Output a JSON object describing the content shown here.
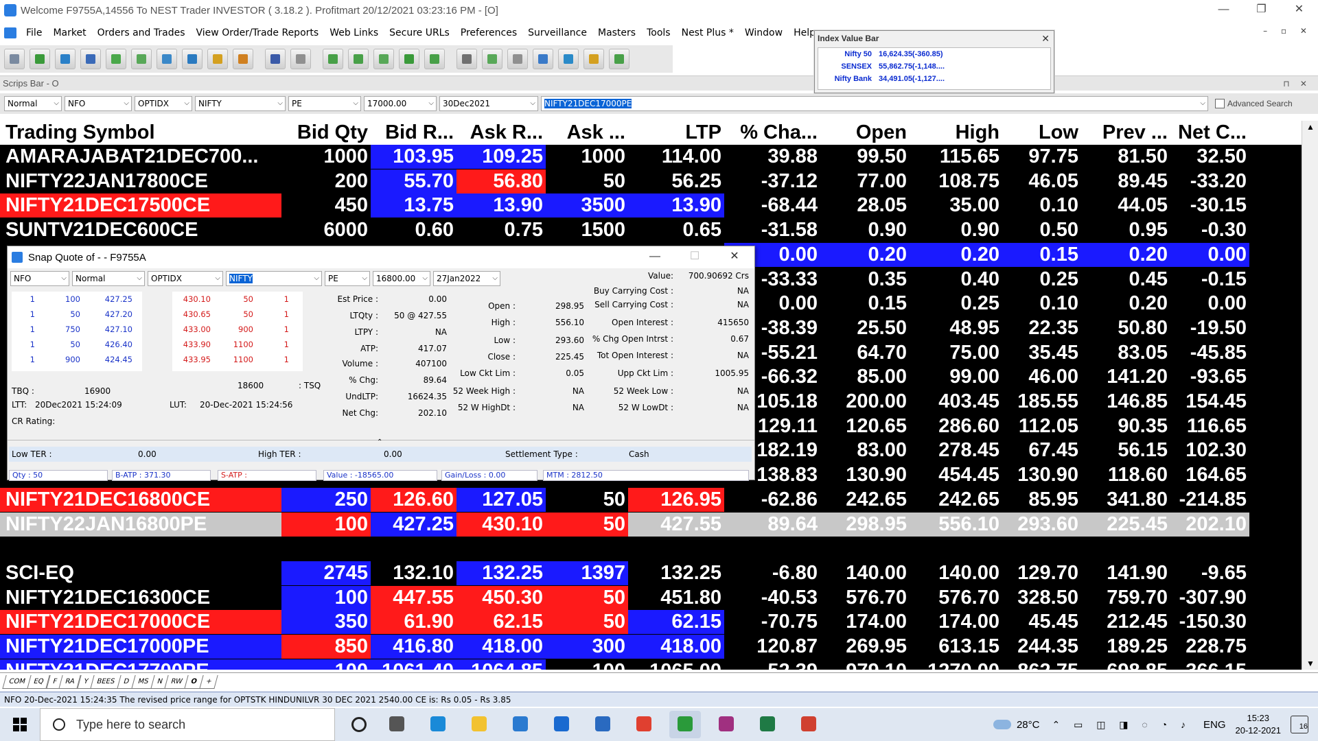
{
  "window": {
    "title": "Welcome F9755A,14556 To NEST Trader INVESTOR ( 3.18.2 ). Profitmart 20/12/2021 03:23:16 PM - [O]",
    "min": "—",
    "restore": "❐",
    "close": "✕"
  },
  "menu": [
    "File",
    "Market",
    "Orders and Trades",
    "View Order/Trade Reports",
    "Web Links",
    "Secure URLs",
    "Preferences",
    "Surveillance",
    "Masters",
    "Tools",
    "Nest Plus *",
    "Window",
    "Help"
  ],
  "mdi_controls": "– ▫ ✕",
  "toolbar_icons": [
    {
      "name": "new-icon",
      "c": "#7a8aa0"
    },
    {
      "name": "add-icon",
      "c": "#3a9a3a"
    },
    {
      "name": "refresh-icon",
      "c": "#2a80c8"
    },
    {
      "name": "search-icon",
      "c": "#3a6ab8"
    },
    {
      "name": "buy-icon",
      "c": "#4aa84a"
    },
    {
      "name": "cart-icon",
      "c": "#58a858"
    },
    {
      "name": "order-icon",
      "c": "#3a88c8"
    },
    {
      "name": "book-icon",
      "c": "#2a7ac0"
    },
    {
      "name": "chart-icon",
      "c": "#d4a020"
    },
    {
      "name": "edit-icon",
      "c": "#d08020"
    },
    {
      "name": "monitor-icon",
      "c": "#3a5aa8"
    },
    {
      "name": "print-icon",
      "c": "#909090"
    },
    {
      "name": "basket-icon",
      "c": "#48a048"
    },
    {
      "name": "basket2-icon",
      "c": "#48a048"
    },
    {
      "name": "download-icon",
      "c": "#58a858"
    },
    {
      "name": "users-icon",
      "c": "#3a9a3a"
    },
    {
      "name": "upload-icon",
      "c": "#48a048"
    },
    {
      "name": "bars-icon",
      "c": "#707070"
    },
    {
      "name": "line-chart-icon",
      "c": "#58a858"
    },
    {
      "name": "camera-icon",
      "c": "#909090"
    },
    {
      "name": "person-icon",
      "c": "#3a7ac8"
    },
    {
      "name": "calc-icon",
      "c": "#2a8ac8"
    },
    {
      "name": "notes-icon",
      "c": "#d4a020"
    },
    {
      "name": "tree-icon",
      "c": "#48a048"
    }
  ],
  "scrips_bar": {
    "label": "Scrips Bar - O",
    "pin": "⊓ ✕"
  },
  "selectors": [
    {
      "v": "Normal",
      "w": 84
    },
    {
      "v": "NFO",
      "w": 98
    },
    {
      "v": "OPTIDX",
      "w": 84
    },
    {
      "v": "NIFTY",
      "w": 132
    },
    {
      "v": "PE",
      "w": 106
    },
    {
      "v": "17000.00",
      "w": 106
    },
    {
      "v": "30Dec2021",
      "w": 144
    }
  ],
  "symbol_input": "NIFTY21DEC17000PE",
  "advanced_search": "Advanced Search",
  "index_bar": {
    "title": "Index Value Bar",
    "close": "✕",
    "rows": [
      {
        "n": "Nifty 50",
        "v": "16,624.35(-360.85)"
      },
      {
        "n": "SENSEX",
        "v": "55,862.75(-1,148...."
      },
      {
        "n": "Nifty Bank",
        "v": "34,491.05(-1,127...."
      }
    ]
  },
  "grid": {
    "headers": [
      "Trading Symbol",
      "Bid Qty",
      "Bid R...",
      "Ask R...",
      "Ask ...",
      "LTP",
      "% Cha...",
      "Open",
      "High",
      "Low",
      "Prev ...",
      "Net C..."
    ],
    "rows": [
      {
        "cells": [
          "AMARAJABAT21DEC700...",
          "1000",
          "103.95",
          "109.25",
          "1000",
          "114.00",
          "39.88",
          "99.50",
          "115.65",
          "97.75",
          "81.50",
          "32.50"
        ],
        "bg": [
          "#000",
          "#000",
          "#1a1aff",
          "#1a1aff",
          "#000",
          "#000",
          "#000",
          "#000",
          "#000",
          "#000",
          "#000",
          "#000"
        ],
        "fg": "#fff"
      },
      {
        "cells": [
          "NIFTY22JAN17800CE",
          "200",
          "55.70",
          "56.80",
          "50",
          "56.25",
          "-37.12",
          "77.00",
          "108.75",
          "46.05",
          "89.45",
          "-33.20"
        ],
        "bg": [
          "#000",
          "#000",
          "#1a1aff",
          "#ff1a1a",
          "#000",
          "#000",
          "#000",
          "#000",
          "#000",
          "#000",
          "#000",
          "#000"
        ],
        "fg": "#fff"
      },
      {
        "cells": [
          "NIFTY21DEC17500CE",
          "450",
          "13.75",
          "13.90",
          "3500",
          "13.90",
          "-68.44",
          "28.05",
          "35.00",
          "0.10",
          "44.05",
          "-30.15"
        ],
        "bg": [
          "#ff1a1a",
          "#000",
          "#1a1aff",
          "#1a1aff",
          "#1a1aff",
          "#1a1aff",
          "#000",
          "#000",
          "#000",
          "#000",
          "#000",
          "#000"
        ],
        "fg": "#fff"
      },
      {
        "cells": [
          "SUNTV21DEC600CE",
          "6000",
          "0.60",
          "0.75",
          "1500",
          "0.65",
          "-31.58",
          "0.90",
          "0.90",
          "0.50",
          "0.95",
          "-0.30"
        ],
        "bg": [
          "#000",
          "#000",
          "#000",
          "#000",
          "#000",
          "#000",
          "#000",
          "#000",
          "#000",
          "#000",
          "#000",
          "#000"
        ],
        "fg": "#fff"
      },
      {
        "cells": [
          "",
          "",
          "",
          "",
          "",
          "",
          "0.00",
          "0.20",
          "0.20",
          "0.15",
          "0.20",
          "0.00"
        ],
        "bg": [
          "#000",
          "#000",
          "#000",
          "#000",
          "#000",
          "#000",
          "#1a1aff",
          "#1a1aff",
          "#1a1aff",
          "#1a1aff",
          "#1a1aff",
          "#1a1aff"
        ],
        "fg": "#fff"
      },
      {
        "cells": [
          "",
          "",
          "",
          "",
          "",
          "",
          "-33.33",
          "0.35",
          "0.40",
          "0.25",
          "0.45",
          "-0.15"
        ],
        "bg": [
          "#000",
          "#000",
          "#000",
          "#000",
          "#000",
          "#000",
          "#000",
          "#000",
          "#000",
          "#000",
          "#000",
          "#000"
        ],
        "fg": "#fff"
      },
      {
        "cells": [
          "",
          "",
          "",
          "",
          "",
          "",
          "0.00",
          "0.15",
          "0.25",
          "0.10",
          "0.20",
          "0.00"
        ],
        "bg": [
          "#000",
          "#000",
          "#000",
          "#000",
          "#000",
          "#000",
          "#000",
          "#000",
          "#000",
          "#000",
          "#000",
          "#000"
        ],
        "fg": "#fff"
      },
      {
        "cells": [
          "",
          "",
          "",
          "",
          "",
          "",
          "-38.39",
          "25.50",
          "48.95",
          "22.35",
          "50.80",
          "-19.50"
        ],
        "bg": [
          "#000",
          "#000",
          "#000",
          "#000",
          "#000",
          "#000",
          "#000",
          "#000",
          "#000",
          "#000",
          "#000",
          "#000"
        ],
        "fg": "#fff"
      },
      {
        "cells": [
          "",
          "",
          "",
          "",
          "",
          "",
          "-55.21",
          "64.70",
          "75.00",
          "35.45",
          "83.05",
          "-45.85"
        ],
        "bg": [
          "#000",
          "#000",
          "#000",
          "#000",
          "#000",
          "#000",
          "#000",
          "#000",
          "#000",
          "#000",
          "#000",
          "#000"
        ],
        "fg": "#fff"
      },
      {
        "cells": [
          "",
          "",
          "",
          "",
          "",
          "",
          "-66.32",
          "85.00",
          "99.00",
          "46.00",
          "141.20",
          "-93.65"
        ],
        "bg": [
          "#000",
          "#000",
          "#000",
          "#000",
          "#000",
          "#000",
          "#000",
          "#000",
          "#000",
          "#000",
          "#000",
          "#000"
        ],
        "fg": "#fff"
      },
      {
        "cells": [
          "",
          "",
          "",
          "",
          "",
          "",
          "105.18",
          "200.00",
          "403.45",
          "185.55",
          "146.85",
          "154.45"
        ],
        "bg": [
          "#000",
          "#000",
          "#000",
          "#000",
          "#000",
          "#000",
          "#000",
          "#000",
          "#000",
          "#000",
          "#000",
          "#000"
        ],
        "fg": "#fff"
      },
      {
        "cells": [
          "",
          "",
          "",
          "",
          "",
          "",
          "129.11",
          "120.65",
          "286.60",
          "112.05",
          "90.35",
          "116.65"
        ],
        "bg": [
          "#000",
          "#000",
          "#000",
          "#000",
          "#000",
          "#000",
          "#000",
          "#000",
          "#000",
          "#000",
          "#000",
          "#000"
        ],
        "fg": "#fff"
      },
      {
        "cells": [
          "",
          "",
          "",
          "",
          "",
          "",
          "182.19",
          "83.00",
          "278.45",
          "67.45",
          "56.15",
          "102.30"
        ],
        "bg": [
          "#000",
          "#000",
          "#000",
          "#000",
          "#000",
          "#000",
          "#000",
          "#000",
          "#000",
          "#000",
          "#000",
          "#000"
        ],
        "fg": "#fff"
      },
      {
        "cells": [
          "",
          "",
          "",
          "",
          "",
          "",
          "138.83",
          "130.90",
          "454.45",
          "130.90",
          "118.60",
          "164.65"
        ],
        "bg": [
          "#000",
          "#000",
          "#000",
          "#000",
          "#000",
          "#000",
          "#000",
          "#000",
          "#000",
          "#000",
          "#000",
          "#000"
        ],
        "fg": "#fff"
      },
      {
        "cells": [
          "NIFTY21DEC16800CE",
          "250",
          "126.60",
          "127.05",
          "50",
          "126.95",
          "-62.86",
          "242.65",
          "242.65",
          "85.95",
          "341.80",
          "-214.85"
        ],
        "bg": [
          "#ff1a1a",
          "#1a1aff",
          "#ff1a1a",
          "#1a1aff",
          "#000",
          "#ff1a1a",
          "#000",
          "#000",
          "#000",
          "#000",
          "#000",
          "#000"
        ],
        "fg": "#fff"
      },
      {
        "cells": [
          "NIFTY22JAN16800PE",
          "100",
          "427.25",
          "430.10",
          "50",
          "427.55",
          "89.64",
          "298.95",
          "556.10",
          "293.60",
          "225.45",
          "202.10"
        ],
        "bg": [
          "#c8c8c8",
          "#ff1a1a",
          "#1a1aff",
          "#ff1a1a",
          "#ff1a1a",
          "#c8c8c8",
          "#c8c8c8",
          "#c8c8c8",
          "#c8c8c8",
          "#c8c8c8",
          "#c8c8c8",
          "#c8c8c8"
        ],
        "fg": "#fff"
      },
      {
        "cells": [
          "",
          "",
          "",
          "",
          "",
          "",
          "",
          "",
          "",
          "",
          "",
          ""
        ],
        "bg": [
          "#000",
          "#000",
          "#000",
          "#000",
          "#000",
          "#000",
          "#000",
          "#000",
          "#000",
          "#000",
          "#000",
          "#000"
        ],
        "fg": "#fff"
      },
      {
        "cells": [
          "SCI-EQ",
          "2745",
          "132.10",
          "132.25",
          "1397",
          "132.25",
          "-6.80",
          "140.00",
          "140.00",
          "129.70",
          "141.90",
          "-9.65"
        ],
        "bg": [
          "#000",
          "#1a1aff",
          "#000",
          "#1a1aff",
          "#1a1aff",
          "#000",
          "#000",
          "#000",
          "#000",
          "#000",
          "#000",
          "#000"
        ],
        "fg": "#fff"
      },
      {
        "cells": [
          "NIFTY21DEC16300CE",
          "100",
          "447.55",
          "450.30",
          "50",
          "451.80",
          "-40.53",
          "576.70",
          "576.70",
          "328.50",
          "759.70",
          "-307.90"
        ],
        "bg": [
          "#000",
          "#1a1aff",
          "#ff1a1a",
          "#ff1a1a",
          "#ff1a1a",
          "#000",
          "#000",
          "#000",
          "#000",
          "#000",
          "#000",
          "#000"
        ],
        "fg": "#fff"
      },
      {
        "cells": [
          "NIFTY21DEC17000CE",
          "350",
          "61.90",
          "62.15",
          "50",
          "62.15",
          "-70.75",
          "174.00",
          "174.00",
          "45.45",
          "212.45",
          "-150.30"
        ],
        "bg": [
          "#ff1a1a",
          "#1a1aff",
          "#ff1a1a",
          "#ff1a1a",
          "#ff1a1a",
          "#1a1aff",
          "#000",
          "#000",
          "#000",
          "#000",
          "#000",
          "#000"
        ],
        "fg": "#fff"
      },
      {
        "cells": [
          "NIFTY21DEC17000PE",
          "850",
          "416.80",
          "418.00",
          "300",
          "418.00",
          "120.87",
          "269.95",
          "613.15",
          "244.35",
          "189.25",
          "228.75"
        ],
        "bg": [
          "#1a1aff",
          "#ff1a1a",
          "#1a1aff",
          "#1a1aff",
          "#1a1aff",
          "#1a1aff",
          "#000",
          "#000",
          "#000",
          "#000",
          "#000",
          "#000"
        ],
        "fg": "#fff"
      },
      {
        "cells": [
          "NIFTY21DEC17700PE",
          "100",
          "1061.40",
          "1064.85",
          "100",
          "1065.00",
          "52.39",
          "979.10",
          "1270.00",
          "862.75",
          "698.85",
          "366.15"
        ],
        "bg": [
          "#1a1aff",
          "#1a1aff",
          "#1a1aff",
          "#1a1aff",
          "#000",
          "#000",
          "#000",
          "#000",
          "#000",
          "#000",
          "#000",
          "#000"
        ],
        "fg": "#fff"
      }
    ]
  },
  "snap": {
    "title": "Snap Quote of  -  - F9755A",
    "controls": {
      "min": "—",
      "max": "☐",
      "close": "✕"
    },
    "selectors": [
      {
        "v": "NFO",
        "w": 86
      },
      {
        "v": "Normal",
        "w": 106
      },
      {
        "v": "OPTIDX",
        "w": 110
      },
      {
        "v": "NIFTY",
        "w": 140
      },
      {
        "v": "PE",
        "w": 66
      },
      {
        "v": "16800.00",
        "w": 84
      },
      {
        "v": "27Jan2022",
        "w": 98
      }
    ],
    "bids": [
      [
        "1",
        "100",
        "427.25"
      ],
      [
        "1",
        "50",
        "427.20"
      ],
      [
        "1",
        "750",
        "427.10"
      ],
      [
        "1",
        "50",
        "426.40"
      ],
      [
        "1",
        "900",
        "424.45"
      ]
    ],
    "asks": [
      [
        "430.10",
        "50",
        "1"
      ],
      [
        "430.65",
        "50",
        "1"
      ],
      [
        "433.00",
        "900",
        "1"
      ],
      [
        "433.90",
        "1100",
        "1"
      ],
      [
        "433.95",
        "1100",
        "1"
      ]
    ],
    "tbq_label": "TBQ :",
    "tbq": "16900",
    "tsq": "18600",
    "tsq_label": ": TSQ",
    "ltt_label": "LTT:",
    "ltt": "20Dec2021 15:24:09",
    "lut_label": "LUT:",
    "lut": "20-Dec-2021 15:24:56",
    "cr_label": "CR Rating:",
    "col1": [
      [
        "Est Price :",
        "0.00"
      ],
      [
        "LTQty :",
        "50 @ 427.55"
      ],
      [
        "LTPY :",
        "NA"
      ],
      [
        "ATP:",
        "417.07"
      ],
      [
        "Volume :",
        "407100"
      ],
      [
        "% Chg:",
        "89.64"
      ],
      [
        "UndLTP:",
        "16624.35"
      ],
      [
        "Net Chg:",
        "202.10"
      ]
    ],
    "col2": [
      [
        "Open :",
        "298.95"
      ],
      [
        "High :",
        "556.10"
      ],
      [
        "Low :",
        "293.60"
      ],
      [
        "Close :",
        "225.45"
      ],
      [
        "Low Ckt Lim :",
        "0.05"
      ],
      [
        "52 Week High :",
        "NA"
      ],
      [
        "52 W HighDt :",
        "NA"
      ]
    ],
    "col3": [
      [
        "Value:",
        "700.90692 Crs"
      ],
      [
        "Buy Carrying Cost :",
        "NA"
      ],
      [
        "Sell Carrying Cost :",
        "NA"
      ],
      [
        "Open Interest :",
        "415650"
      ],
      [
        "% Chg Open Intrst :",
        "0.67"
      ],
      [
        "Tot Open Interest :",
        "NA"
      ],
      [
        "Upp Ckt Lim :",
        "1005.95"
      ],
      [
        "52 Week Low :",
        "NA"
      ],
      [
        "52 W LowDt :",
        "NA"
      ]
    ],
    "low_ter_label": "Low TER :",
    "low_ter": "0.00",
    "high_ter_label": "High TER :",
    "high_ter": "0.00",
    "settle_label": "Settlement Type :",
    "settle": "Cash",
    "status": [
      "Qty : 50",
      "B-ATP : 371.30",
      "S-ATP :",
      "Value : -18565.00",
      "Gain/Loss : 0.00",
      "MTM : 2812.50"
    ]
  },
  "tabs": [
    "COM",
    "EQ",
    "F",
    "RA",
    "Y",
    "BEES",
    "D",
    "MS",
    "N",
    "RW",
    "O",
    "+"
  ],
  "active_tab": "O",
  "ticker": "NFO 20-Dec-2021 15:24:35 The revised price range for OPTSTK HINDUNILVR 30 DEC 2021 2540.00 CE is: Rs 0.05 - Rs 3.85",
  "taskbar": {
    "search": "Type here to search",
    "apps": [
      {
        "name": "task-view-icon",
        "c": "#555"
      },
      {
        "name": "edge-icon",
        "c": "#1a8ad8"
      },
      {
        "name": "explorer-icon",
        "c": "#f2c230"
      },
      {
        "name": "store-icon",
        "c": "#2a7ad0"
      },
      {
        "name": "mail-icon",
        "c": "#1a6ad0"
      },
      {
        "name": "remote-desktop-icon",
        "c": "#2a6ac0"
      },
      {
        "name": "chrome-icon",
        "c": "#e04030"
      },
      {
        "name": "nest-app-icon",
        "c": "#2a9a3a"
      },
      {
        "name": "winrar-icon",
        "c": "#a03080"
      },
      {
        "name": "excel-icon",
        "c": "#1f7a45"
      },
      {
        "name": "chrome-alt-icon",
        "c": "#d04030"
      }
    ],
    "weather": "28°C",
    "lang": "ENG",
    "time": "15:23",
    "date": "20-12-2021",
    "notif": "16"
  }
}
